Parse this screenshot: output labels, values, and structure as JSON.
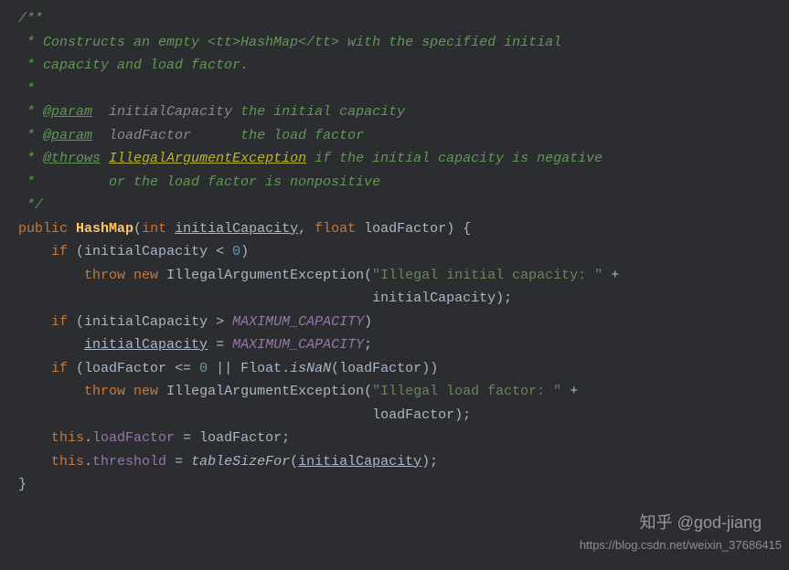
{
  "doc": {
    "l1": "/**",
    "l2": " * Constructs an empty <tt>HashMap</tt> with the specified initial",
    "l3": " * capacity and load factor.",
    "l4": " *",
    "l5a": " * ",
    "tag_param1": "@param",
    "var1": "initialCapacity",
    "desc1": " the initial capacity",
    "l6a": " * ",
    "tag_param2": "@param",
    "var2": "loadFactor",
    "desc2": "      the load factor",
    "l7a": " * ",
    "tag_throws": "@throws",
    "exc": "IllegalArgumentException",
    "desc3": " if the initial capacity is negative",
    "l8": " *         or the load factor is nonpositive",
    "l9": " */"
  },
  "code": {
    "public": "public",
    "hashmap": "HashMap",
    "int": "int",
    "initialCapacity": "initialCapacity",
    "float": "float",
    "loadFactor": "loadFactor",
    "if": "if",
    "zero": "0",
    "throw": "throw",
    "new": "new",
    "iae": "IllegalArgumentException",
    "str1": "\"Illegal initial capacity: \"",
    "maxcap": "MAXIMUM_CAPACITY",
    "isNaN": "isNaN",
    "float_cls": "Float",
    "str2": "\"Illegal load factor: \"",
    "this": "this",
    "loadFactor_f": "loadFactor",
    "threshold_f": "threshold",
    "tableSizeFor": "tableSizeFor"
  },
  "wm": {
    "zhihu": "知乎 @god-jiang",
    "csdn": "https://blog.csdn.net/weixin_37686415"
  }
}
